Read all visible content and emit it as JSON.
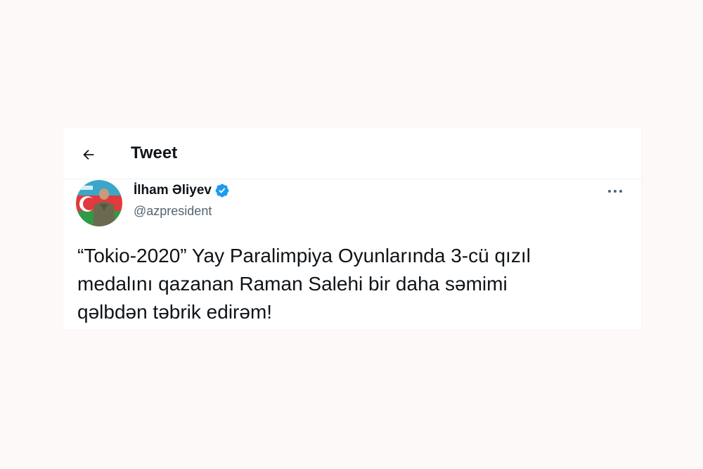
{
  "header": {
    "title": "Tweet",
    "back_icon": "arrow-left-icon"
  },
  "author": {
    "name": "İlham Əliyev",
    "handle": "@azpresident",
    "verified": true,
    "verified_color": "#1d9bf0"
  },
  "more_icon": "more-horizontal-icon",
  "tweet": {
    "text": "“Tokio-2020” Yay Paralimpiya Oyunlarında 3-cü qızıl\nmedalını qazanan Raman Salehi bir daha səmimi\nqəlbdən təbrik edirəm!"
  },
  "colors": {
    "page_bg": "#fcf9f8",
    "card_bg": "#ffffff",
    "text_primary": "#0f1419",
    "text_secondary": "#536471"
  }
}
